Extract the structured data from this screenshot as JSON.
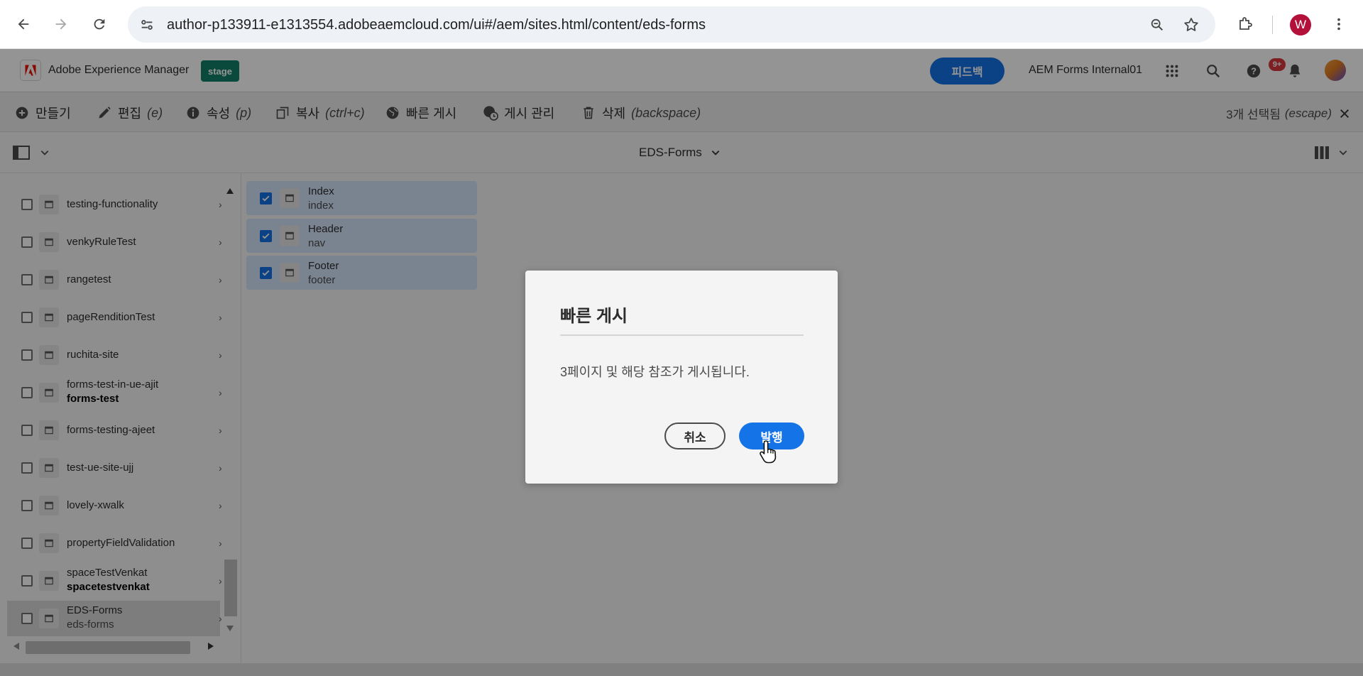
{
  "browser": {
    "url": "author-p133911-e1313554.adobeaemcloud.com/ui#/aem/sites.html/content/eds-forms",
    "profile_initial": "W"
  },
  "aem_header": {
    "app_name": "Adobe Experience Manager",
    "env_badge": "stage",
    "feedback_label": "피드백",
    "org_name": "AEM Forms Internal01",
    "notification_count": "9+"
  },
  "actions": [
    {
      "label": "만들기",
      "shortcut": "",
      "icon": "plus-circle-icon"
    },
    {
      "label": "편집",
      "shortcut": "(e)",
      "icon": "pencil-icon"
    },
    {
      "label": "속성",
      "shortcut": "(p)",
      "icon": "info-icon"
    },
    {
      "label": "복사",
      "shortcut": "(ctrl+c)",
      "icon": "copy-icon"
    },
    {
      "label": "빠른 게시",
      "shortcut": "",
      "icon": "globe-icon"
    },
    {
      "label": "게시 관리",
      "shortcut": "",
      "icon": "globe-clock-icon"
    },
    {
      "label": "삭제",
      "shortcut": "(backspace)",
      "icon": "trash-icon"
    }
  ],
  "selection": {
    "label": "3개 선택됨",
    "shortcut": "(escape)"
  },
  "breadcrumb": {
    "title": "EDS-Forms"
  },
  "column1": {
    "items": [
      {
        "title": "testing-functionality",
        "sub": ""
      },
      {
        "title": "venkyRuleTest",
        "sub": ""
      },
      {
        "title": "rangetest",
        "sub": ""
      },
      {
        "title": "pageRenditionTest",
        "sub": ""
      },
      {
        "title": "ruchita-site",
        "sub": ""
      },
      {
        "title": "forms-test-in-ue-ajit",
        "sub": "forms-test"
      },
      {
        "title": "forms-testing-ajeet",
        "sub": ""
      },
      {
        "title": "test-ue-site-ujj",
        "sub": ""
      },
      {
        "title": "lovely-xwalk",
        "sub": ""
      },
      {
        "title": "propertyFieldValidation",
        "sub": ""
      },
      {
        "title": "spaceTestVenkat",
        "sub": "spacetestvenkat"
      },
      {
        "title": "EDS-Forms",
        "sub": "eds-forms"
      }
    ]
  },
  "column2": {
    "items": [
      {
        "title": "Index",
        "sub": "index",
        "checked": true
      },
      {
        "title": "Header",
        "sub": "nav",
        "checked": true
      },
      {
        "title": "Footer",
        "sub": "footer",
        "checked": true
      }
    ]
  },
  "dialog": {
    "title": "빠른 게시",
    "message": "3페이지 및 해당 참조가 게시됩니다.",
    "cancel_label": "취소",
    "publish_label": "발행"
  },
  "colors": {
    "accent": "#1473e6",
    "stage": "#12806a",
    "badge": "#d7373f",
    "selected_card": "#d2e3f8"
  }
}
